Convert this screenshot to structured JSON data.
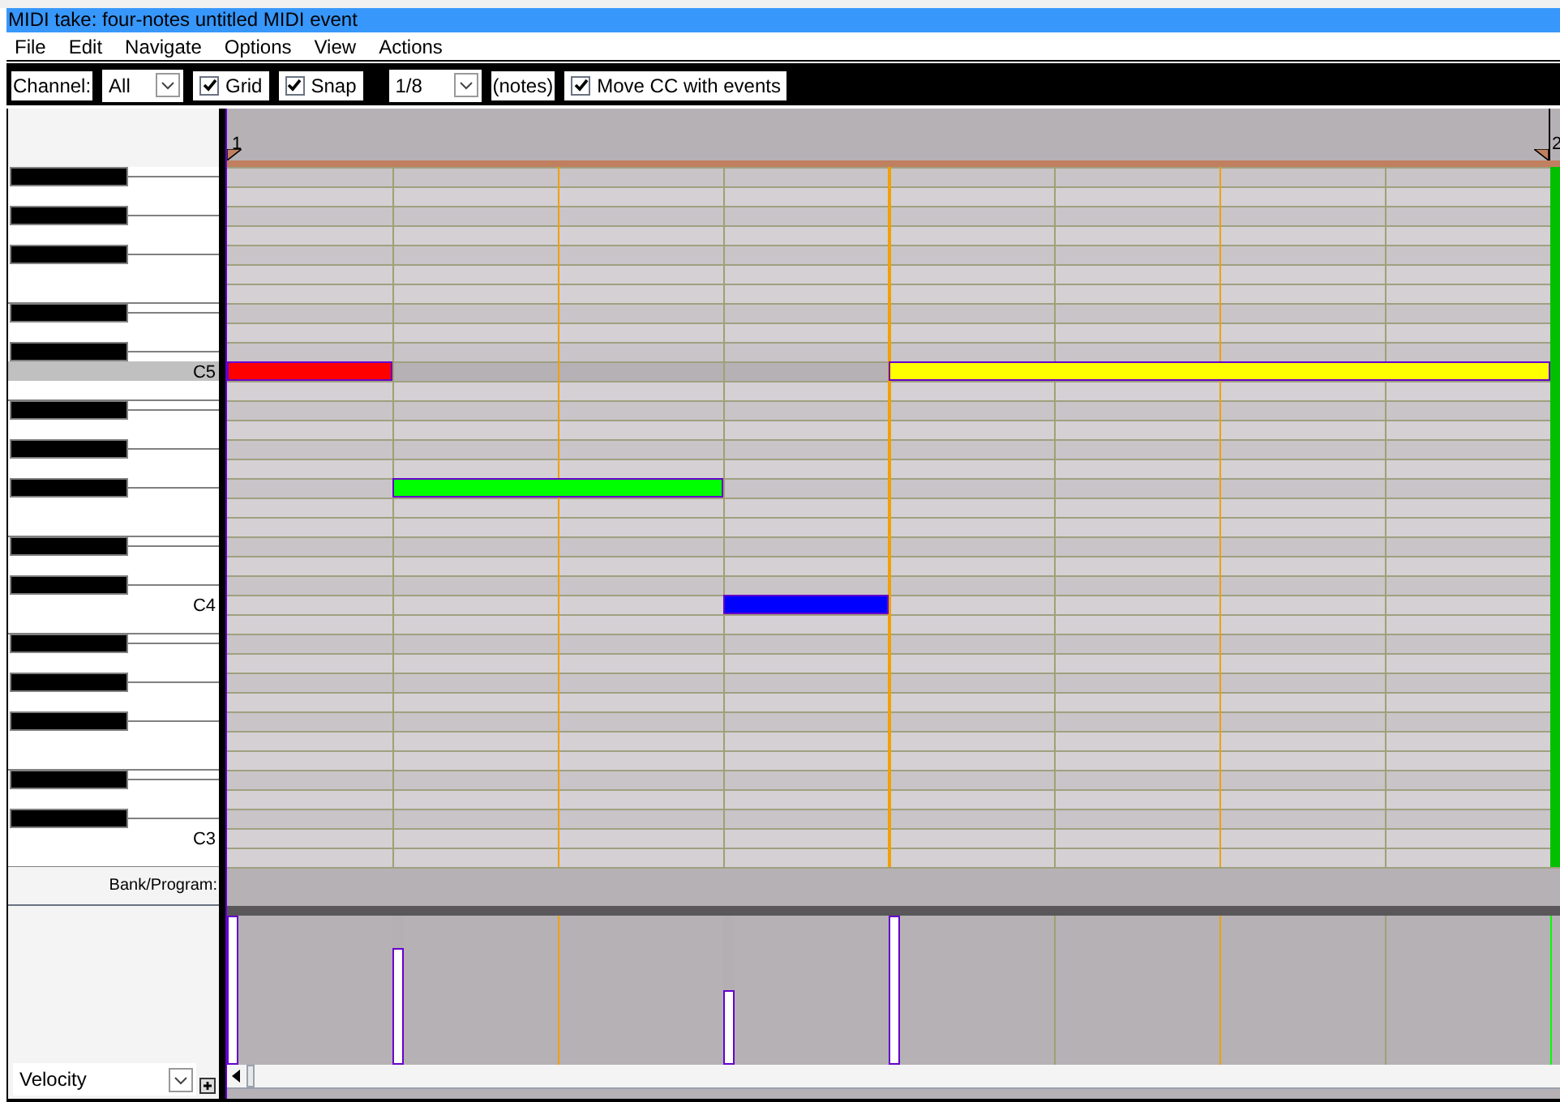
{
  "window": {
    "title": "MIDI take: four-notes untitled MIDI event"
  },
  "menu": [
    "File",
    "Edit",
    "Navigate",
    "Options",
    "View",
    "Actions"
  ],
  "toolbar": {
    "channel_label": "Channel:",
    "channel": "All",
    "grid": {
      "label": "Grid",
      "checked": true
    },
    "snap": {
      "label": "Snap",
      "checked": true
    },
    "division": "1/8",
    "division_unit": "(notes)",
    "move_cc": {
      "label": "Move CC with events",
      "checked": true
    }
  },
  "ruler": [
    "1",
    "2"
  ],
  "keyboard": {
    "labels": [
      "C5",
      "C4",
      "C3"
    ]
  },
  "notes": [
    {
      "color": "#ff0000",
      "level": 1
    },
    {
      "color": "#00ff00",
      "level": 0.78
    },
    {
      "color": "#0000ff",
      "level": 0.5
    },
    {
      "color": "#ffff00",
      "level": 1
    }
  ],
  "lanes": {
    "bank_program": "Bank/Program:",
    "cc_lane": "Velocity"
  }
}
